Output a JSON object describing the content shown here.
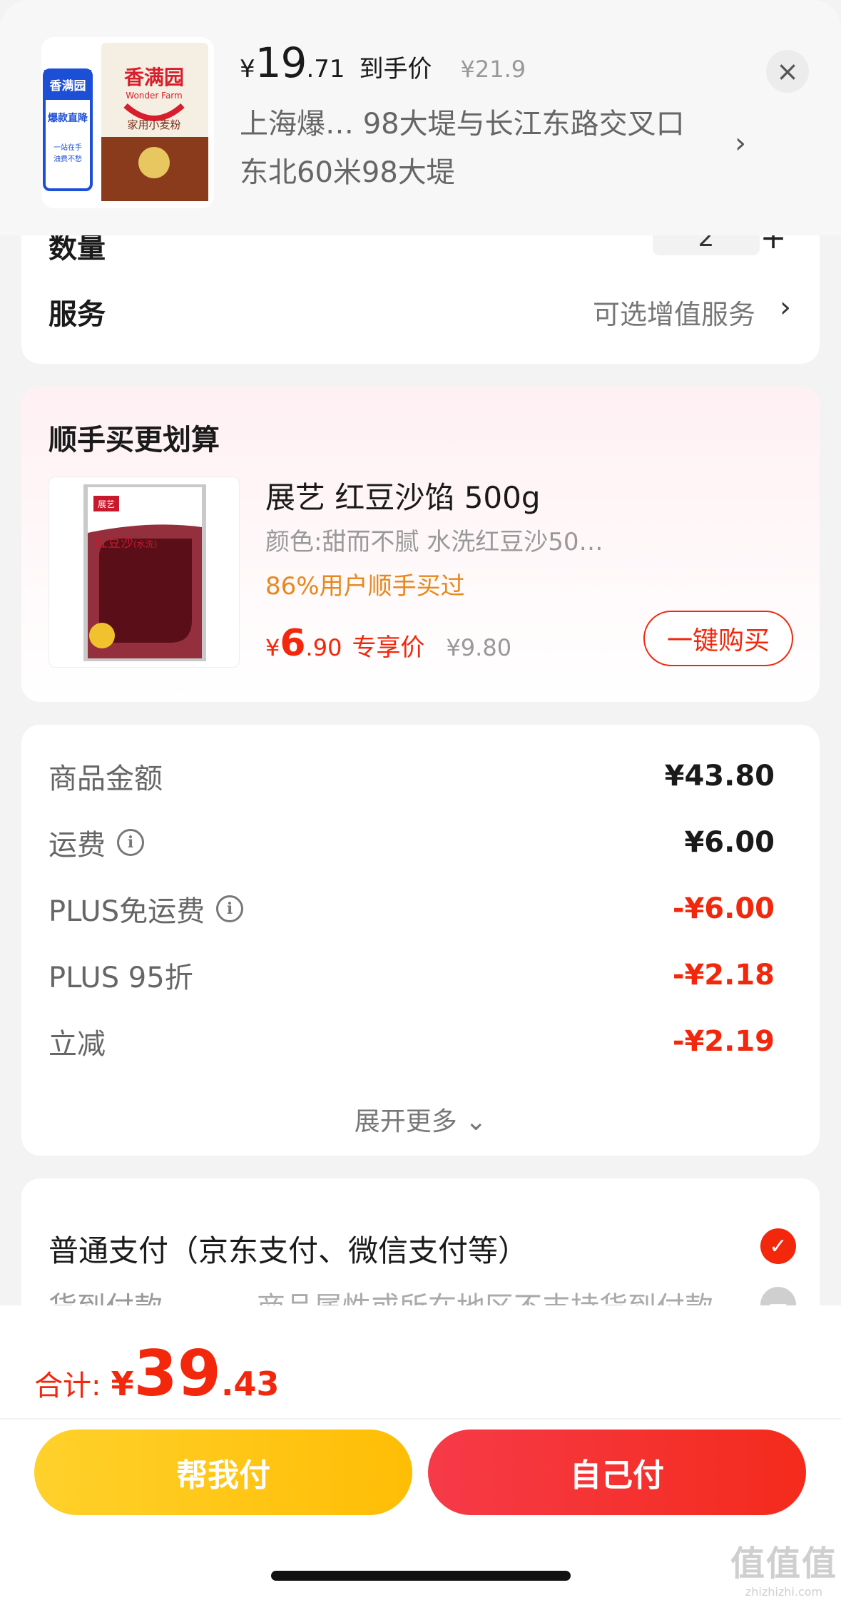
{
  "header": {
    "price_yen": "¥",
    "price_int": "19",
    "price_dec": ".71",
    "price_tag": "到手价",
    "orig_price": "¥21.9",
    "address_line1": "上海爆… 98大堤与长江东路交叉口",
    "address_line2": "东北60米98大堤",
    "chevron": "›",
    "close_glyph": "×",
    "product_brand": "香满园",
    "product_brand_en": "Wonder Farm",
    "product_name": "家用小麦粉",
    "badge_top": "香满园",
    "badge_mid": "爆款直降",
    "badge_low1": "一站在手",
    "badge_low2": "油费不愁"
  },
  "quantity": {
    "label": "数量",
    "value": "2",
    "plus": "+"
  },
  "service": {
    "label": "服务",
    "value": "可选增值服务",
    "chevron": "›"
  },
  "addon": {
    "title": "顺手买更划算",
    "name": "展艺 红豆沙馅 500g",
    "spec": "颜色:甜而不腻 水洗红豆沙50…",
    "rate": "86%用户顺手买过",
    "price_yen": "¥",
    "price_int": "6",
    "price_dec": ".90",
    "price_tag": "专享价",
    "orig_price": "¥9.80",
    "buy_label": "一键购买",
    "pkg_brand": "展艺",
    "pkg_name": "红豆沙",
    "pkg_sub": "(水洗)"
  },
  "summary": {
    "rows": [
      {
        "label": "商品金额",
        "value": "¥43.80",
        "info": false,
        "red": false
      },
      {
        "label": "运费",
        "value": "¥6.00",
        "info": true,
        "red": false
      },
      {
        "label": "PLUS免运费",
        "value": "-¥6.00",
        "info": true,
        "red": true
      },
      {
        "label": "PLUS 95折",
        "value": "-¥2.18",
        "info": false,
        "red": true
      },
      {
        "label": "立减",
        "value": "-¥2.19",
        "info": false,
        "red": true
      }
    ],
    "expand_label": "展开更多 ⌄"
  },
  "payment": {
    "normal_label": "普通支付（京东支付、微信支付等）",
    "cod_label": "货到付款",
    "cod_note": "商品属性或所在地区不支持货到付款",
    "check_glyph": "✓",
    "disabled_glyph": "−"
  },
  "bottom": {
    "total_label": "合计:",
    "total_yen": "¥",
    "total_int": "39",
    "total_dec": ".43",
    "help_pay_label": "帮我付",
    "self_pay_label": "自己付",
    "watermark": "值值值",
    "watermark_sub": "zhizhizhi.com"
  },
  "colors": {
    "accent_red": "#f2270c",
    "orange_rate": "#e8871e",
    "yellow_button": "#ffc107"
  }
}
